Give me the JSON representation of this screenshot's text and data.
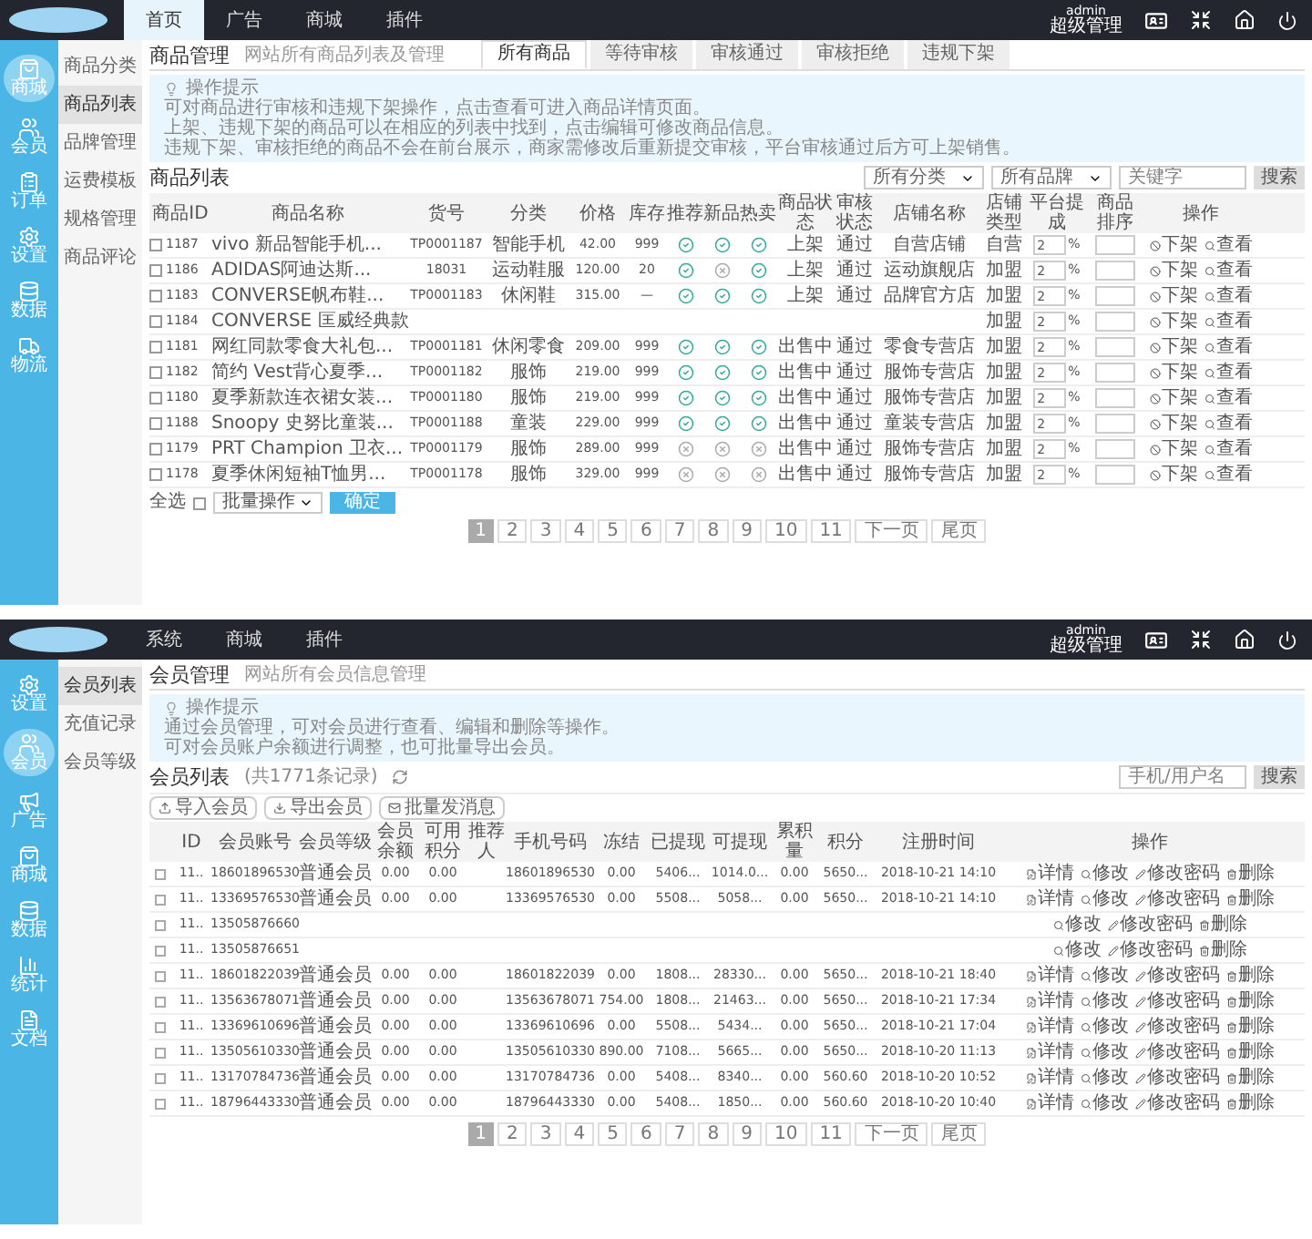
{
  "screens": [
    {
      "header": {
        "nav": [
          {
            "label": "首页",
            "selected": true
          },
          {
            "label": "广告",
            "selected": false
          },
          {
            "label": "商城",
            "selected": false
          },
          {
            "label": "插件",
            "selected": false
          }
        ],
        "user": "admin",
        "role": "超级管理"
      },
      "sidebar": [
        {
          "label": "商城",
          "selected": true
        },
        {
          "label": "会员",
          "selected": false
        },
        {
          "label": "订单",
          "selected": false
        },
        {
          "label": "设置",
          "selected": false
        },
        {
          "label": "数据",
          "selected": false
        },
        {
          "label": "物流",
          "selected": false
        }
      ],
      "submenu": [
        {
          "label": "商品分类",
          "selected": false
        },
        {
          "label": "商品列表",
          "selected": true
        },
        {
          "label": "品牌管理",
          "selected": false
        },
        {
          "label": "运费模板",
          "selected": false
        },
        {
          "label": "规格管理",
          "selected": false
        },
        {
          "label": "商品评论",
          "selected": false
        }
      ],
      "title": "商品管理",
      "subtitle": "网站所有商品列表及管理",
      "tabs": [
        {
          "label": "所有商品",
          "selected": true
        },
        {
          "label": "等待审核",
          "selected": false
        },
        {
          "label": "审核通过",
          "selected": false
        },
        {
          "label": "审核拒绝",
          "selected": false
        },
        {
          "label": "违规下架",
          "selected": false
        }
      ],
      "tips": {
        "title": "操作提示",
        "lines": [
          "可对商品进行审核和违规下架操作，点击查看可进入商品详情页面。",
          "上架、违规下架的商品可以在相应的列表中找到，点击编辑可修改商品信息。",
          "违规下架、审核拒绝的商品不会在前台展示，商家需修改后重新提交审核，平台审核通过后方可上架销售。"
        ]
      },
      "list": {
        "title": "商品列表",
        "filters": [
          "所有分类",
          "所有品牌"
        ],
        "search_placeholder": "关键字",
        "search_button": "搜索"
      },
      "kind": "goods",
      "percent": "%",
      "columns": [
        "商品ID",
        "商品名称",
        "货号",
        "分类",
        "价格",
        "库存",
        "推荐",
        "新品",
        "热卖",
        "商品状态",
        "审核状态",
        "店铺名称",
        "店铺类型",
        "平台提成",
        "商品排序",
        "操作"
      ],
      "rows": [
        {
          "checked": false,
          "id": "1187",
          "name": "vivo 新品智能手机...",
          "sn": "TP0001187",
          "cat": "智能手机",
          "price": "42.00",
          "stock": "999",
          "rec": true,
          "new": true,
          "hot": true,
          "status": "上架",
          "audit": "通过",
          "shop": "自营店铺",
          "type": "自营",
          "ratio": "2",
          "actions": [
            "下架",
            "查看"
          ]
        },
        {
          "checked": false,
          "id": "1186",
          "name": "ADIDAS阿迪达斯...",
          "sn": "18031",
          "cat": "运动鞋服",
          "price": "120.00",
          "stock": "20",
          "rec": true,
          "new": false,
          "hot": true,
          "status": "上架",
          "audit": "通过",
          "shop": "运动旗舰店",
          "type": "加盟",
          "ratio": "2",
          "actions": [
            "下架",
            "查看"
          ]
        },
        {
          "checked": false,
          "id": "1183",
          "name": "CONVERSE帆布鞋...",
          "sn": "TP0001183",
          "cat": "休闲鞋",
          "price": "315.00",
          "stock": "—",
          "rec": true,
          "new": true,
          "hot": true,
          "status": "上架",
          "audit": "通过",
          "shop": "品牌官方店",
          "type": "加盟",
          "ratio": "2",
          "actions": [
            "下架",
            "查看"
          ]
        },
        {
          "checked": false,
          "id": "1184",
          "name": "CONVERSE 匡威经典款",
          "type": "加盟",
          "ratio": "2",
          "actions": [
            "下架",
            "查看"
          ]
        },
        {
          "checked": false,
          "id": "1181",
          "name": "网红同款零食大礼包...",
          "sn": "TP0001181",
          "cat": "休闲零食",
          "price": "209.00",
          "stock": "999",
          "rec": true,
          "new": true,
          "hot": true,
          "status": "出售中",
          "audit": "通过",
          "shop": "零食专营店",
          "type": "加盟",
          "ratio": "2",
          "actions": [
            "下架",
            "查看"
          ]
        },
        {
          "checked": false,
          "id": "1182",
          "name": "简约 Vest背心夏季...",
          "sn": "TP0001182",
          "cat": "服饰",
          "price": "219.00",
          "stock": "999",
          "rec": true,
          "new": true,
          "hot": true,
          "status": "出售中",
          "audit": "通过",
          "shop": "服饰专营店",
          "type": "加盟",
          "ratio": "2",
          "actions": [
            "下架",
            "查看"
          ]
        },
        {
          "checked": false,
          "id": "1180",
          "name": "夏季新款连衣裙女装...",
          "sn": "TP0001180",
          "cat": "服饰",
          "price": "219.00",
          "stock": "999",
          "rec": true,
          "new": true,
          "hot": true,
          "status": "出售中",
          "audit": "通过",
          "shop": "服饰专营店",
          "type": "加盟",
          "ratio": "2",
          "actions": [
            "下架",
            "查看"
          ]
        },
        {
          "checked": false,
          "id": "1188",
          "name": "Snoopy 史努比童装...",
          "sn": "TP0001188",
          "cat": "童装",
          "price": "229.00",
          "stock": "999",
          "rec": true,
          "new": true,
          "hot": true,
          "status": "出售中",
          "audit": "通过",
          "shop": "童装专营店",
          "type": "加盟",
          "ratio": "2",
          "actions": [
            "下架",
            "查看"
          ]
        },
        {
          "checked": false,
          "id": "1179",
          "name": "PRT Champion 卫衣...",
          "sn": "TP0001179",
          "cat": "服饰",
          "price": "289.00",
          "stock": "999",
          "rec": false,
          "new": false,
          "hot": false,
          "status": "出售中",
          "audit": "通过",
          "shop": "服饰专营店",
          "type": "加盟",
          "ratio": "2",
          "actions": [
            "下架",
            "查看"
          ]
        },
        {
          "checked": false,
          "id": "1178",
          "name": "夏季休闲短袖T恤男...",
          "sn": "TP0001178",
          "cat": "服饰",
          "price": "329.00",
          "stock": "999",
          "rec": false,
          "new": false,
          "hot": false,
          "status": "出售中",
          "audit": "通过",
          "shop": "服饰专营店",
          "type": "加盟",
          "ratio": "2",
          "actions": [
            "下架",
            "查看"
          ]
        }
      ],
      "batch": {
        "checked": false,
        "label": "全选",
        "select": "批量操作",
        "button": "确定"
      },
      "pages": [
        {
          "label": "1",
          "selected": true
        },
        {
          "label": "2",
          "selected": false
        },
        {
          "label": "3",
          "selected": false
        },
        {
          "label": "4",
          "selected": false
        },
        {
          "label": "5",
          "selected": false
        },
        {
          "label": "6",
          "selected": false
        },
        {
          "label": "7",
          "selected": false
        },
        {
          "label": "8",
          "selected": false
        },
        {
          "label": "9",
          "selected": false
        },
        {
          "label": "10",
          "selected": false
        },
        {
          "label": "11",
          "selected": false
        },
        {
          "label": "下一页",
          "selected": false
        },
        {
          "label": "尾页",
          "selected": false
        }
      ]
    },
    {
      "header": {
        "nav": [
          {
            "label": "系统",
            "selected": false
          },
          {
            "label": "商城",
            "selected": false
          },
          {
            "label": "插件",
            "selected": false
          }
        ],
        "user": "admin",
        "role": "超级管理"
      },
      "sidebar": [
        {
          "label": "设置",
          "selected": false
        },
        {
          "label": "会员",
          "selected": true
        },
        {
          "label": "广告",
          "selected": false
        },
        {
          "label": "商城",
          "selected": false
        },
        {
          "label": "数据",
          "selected": false
        },
        {
          "label": "统计",
          "selected": false
        },
        {
          "label": "文档",
          "selected": false
        }
      ],
      "submenu": [
        {
          "label": "会员列表",
          "selected": true
        },
        {
          "label": "充值记录",
          "selected": false
        },
        {
          "label": "会员等级",
          "selected": false
        }
      ],
      "title": "会员管理",
      "subtitle": "网站所有会员信息管理",
      "tips": {
        "title": "操作提示",
        "lines": [
          "通过会员管理，可对会员进行查看、编辑和删除等操作。",
          "可对会员账户余额进行调整，也可批量导出会员。"
        ]
      },
      "list": {
        "title": "会员列表",
        "count": "(共1771条记录)",
        "search_placeholder": "手机/用户名",
        "search_button": "搜索"
      },
      "kind": "members",
      "toolbar": [
        "导入会员",
        "导出会员",
        "批量发消息"
      ],
      "columns": [
        "ID",
        "会员账号",
        "会员等级",
        "会员余额",
        "可用积分",
        "推荐人",
        "手机号码",
        "冻结",
        "已提现",
        "可提现",
        "累积量",
        "积分",
        "注册时间",
        "操作"
      ],
      "rows": [
        {
          "checked": false,
          "id": "11..",
          "account": "18601896530",
          "level": "普通会员",
          "balance": "0.00",
          "points": "0.00",
          "phone": "18601896530",
          "frozen": "0.00",
          "withdrawn": "5406...",
          "available": "1014.0...",
          "total": "0.00",
          "score": "5650...",
          "time": "2018-10-21 14:10",
          "actions": [
            "详情",
            "修改",
            "修改密码",
            "删除"
          ]
        },
        {
          "checked": false,
          "id": "11..",
          "account": "13369576530",
          "level": "普通会员",
          "balance": "0.00",
          "points": "0.00",
          "phone": "13369576530",
          "frozen": "0.00",
          "withdrawn": "5508...",
          "available": "5058...",
          "total": "0.00",
          "score": "5650...",
          "time": "2018-10-21 14:10",
          "actions": [
            "详情",
            "修改",
            "修改密码",
            "删除"
          ]
        },
        {
          "checked": false,
          "id": "11..",
          "account": "13505876660",
          "actions": [
            "修改",
            "修改密码",
            "删除"
          ]
        },
        {
          "checked": false,
          "id": "11..",
          "account": "13505876651",
          "actions": [
            "修改",
            "修改密码",
            "删除"
          ]
        },
        {
          "checked": false,
          "id": "11..",
          "account": "18601822039",
          "level": "普通会员",
          "balance": "0.00",
          "points": "0.00",
          "phone": "18601822039",
          "frozen": "0.00",
          "withdrawn": "1808...",
          "available": "28330...",
          "total": "0.00",
          "score": "5650...",
          "time": "2018-10-21 18:40",
          "actions": [
            "详情",
            "修改",
            "修改密码",
            "删除"
          ]
        },
        {
          "checked": false,
          "id": "11..",
          "account": "13563678071",
          "level": "普通会员",
          "balance": "0.00",
          "points": "0.00",
          "phone": "13563678071",
          "frozen": "754.00",
          "withdrawn": "1808...",
          "available": "21463...",
          "total": "0.00",
          "score": "5650...",
          "time": "2018-10-21 17:34",
          "actions": [
            "详情",
            "修改",
            "修改密码",
            "删除"
          ]
        },
        {
          "checked": false,
          "id": "11..",
          "account": "13369610696",
          "level": "普通会员",
          "balance": "0.00",
          "points": "0.00",
          "phone": "13369610696",
          "frozen": "0.00",
          "withdrawn": "5508...",
          "available": "5434...",
          "total": "0.00",
          "score": "5650...",
          "time": "2018-10-21 17:04",
          "actions": [
            "详情",
            "修改",
            "修改密码",
            "删除"
          ]
        },
        {
          "checked": false,
          "id": "11..",
          "account": "13505610330",
          "level": "普通会员",
          "balance": "0.00",
          "points": "0.00",
          "phone": "13505610330",
          "frozen": "890.00",
          "withdrawn": "7108...",
          "available": "5665...",
          "total": "0.00",
          "score": "5650...",
          "time": "2018-10-20 11:13",
          "actions": [
            "详情",
            "修改",
            "修改密码",
            "删除"
          ]
        },
        {
          "checked": false,
          "id": "11..",
          "account": "13170784736",
          "level": "普通会员",
          "balance": "0.00",
          "points": "0.00",
          "phone": "13170784736",
          "frozen": "0.00",
          "withdrawn": "5408...",
          "available": "8340...",
          "total": "0.00",
          "score": "560.60",
          "time": "2018-10-20 10:52",
          "actions": [
            "详情",
            "修改",
            "修改密码",
            "删除"
          ]
        },
        {
          "checked": false,
          "id": "11..",
          "account": "18796443330",
          "level": "普通会员",
          "balance": "0.00",
          "points": "0.00",
          "phone": "18796443330",
          "frozen": "0.00",
          "withdrawn": "5408...",
          "available": "1850...",
          "total": "0.00",
          "score": "560.60",
          "time": "2018-10-20 10:40",
          "actions": [
            "详情",
            "修改",
            "修改密码",
            "删除"
          ]
        }
      ],
      "pages": [
        {
          "label": "1",
          "selected": true
        },
        {
          "label": "2",
          "selected": false
        },
        {
          "label": "3",
          "selected": false
        },
        {
          "label": "4",
          "selected": false
        },
        {
          "label": "5",
          "selected": false
        },
        {
          "label": "6",
          "selected": false
        },
        {
          "label": "7",
          "selected": false
        },
        {
          "label": "8",
          "selected": false
        },
        {
          "label": "9",
          "selected": false
        },
        {
          "label": "10",
          "selected": false
        },
        {
          "label": "11",
          "selected": false
        },
        {
          "label": "下一页",
          "selected": false
        },
        {
          "label": "尾页",
          "selected": false
        }
      ]
    }
  ]
}
